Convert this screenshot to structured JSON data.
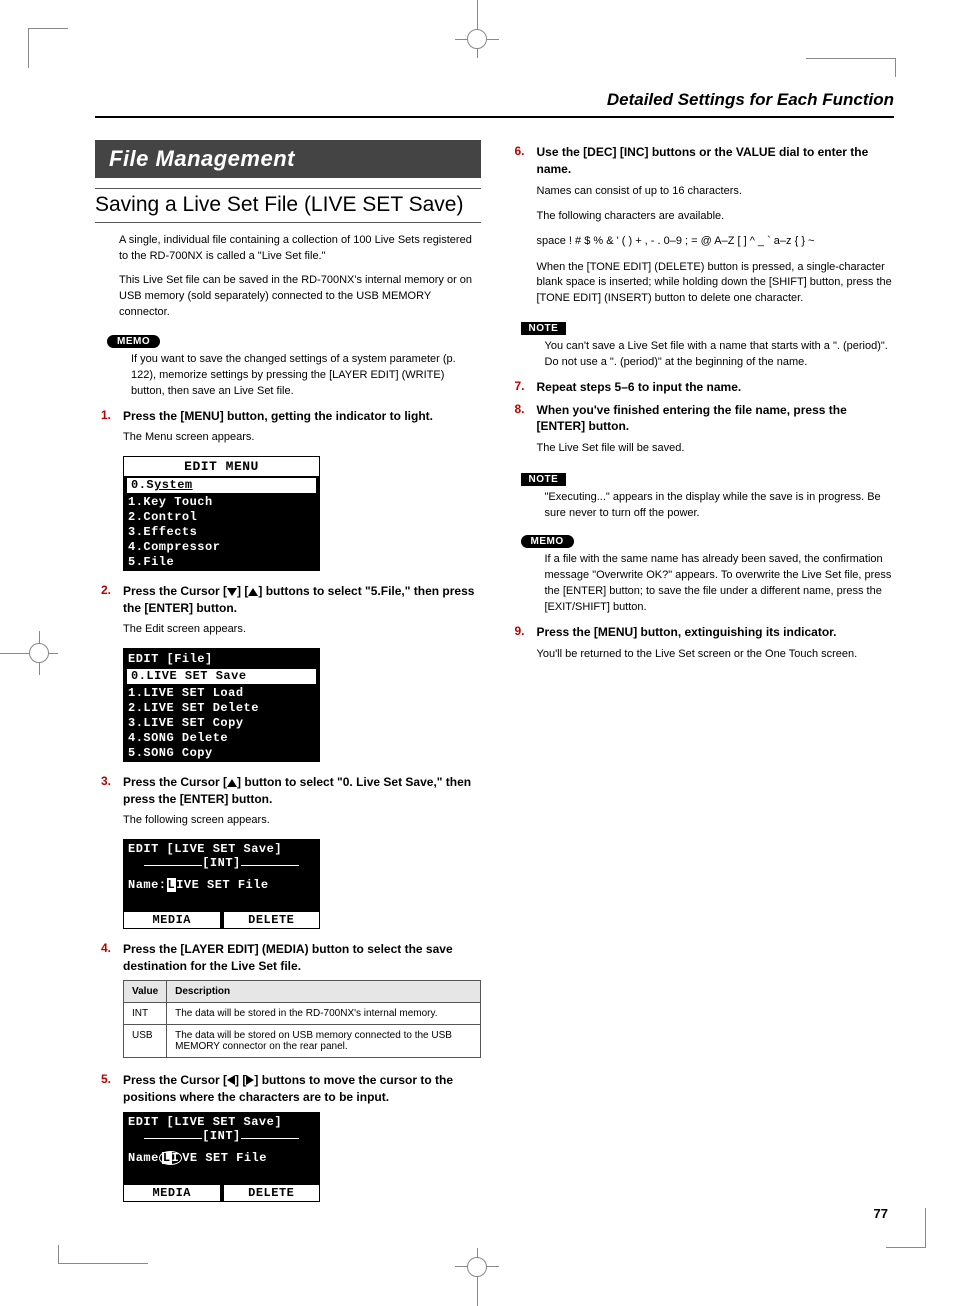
{
  "header": {
    "title": "Detailed Settings for Each Function",
    "page": "77"
  },
  "banner": "File Management",
  "subsection": "Saving a Live Set File  (LIVE SET Save)",
  "intro1": "A single, individual file containing a collection of 100 Live Sets registered to the RD-700NX is called a \"Live Set file.\"",
  "intro2": "This Live Set file can be saved in the RD-700NX's internal memory or on USB memory (sold separately) connected to the USB MEMORY connector.",
  "memo1": {
    "label": "MEMO",
    "text": "If you want to save the changed settings of a system parameter (p. 122), memorize settings by pressing the [LAYER EDIT] (WRITE) button, then save an Live Set file."
  },
  "steps": {
    "s1": {
      "num": "1.",
      "text": "Press the [MENU] button, getting the indicator to light.",
      "note": "The Menu screen appears."
    },
    "s2": {
      "num": "2.",
      "prefix": "Press the Cursor [",
      "mid1": "] [",
      "mid2": "] buttons to select \"5.File,\" then press the [ENTER] button.",
      "note": "The Edit screen appears."
    },
    "s3": {
      "num": "3.",
      "prefix": "Press the Cursor [",
      "mid": "] button to select \"0. Live Set Save,\" then press the [ENTER] button.",
      "note": "The following screen appears."
    },
    "s4": {
      "num": "4.",
      "text": "Press the [LAYER EDIT] (MEDIA) button to select the save destination for the Live Set file."
    },
    "s5": {
      "num": "5.",
      "prefix": "Press the Cursor [",
      "mid1": "] [",
      "mid2": "] buttons to move the cursor to the positions where the characters are to be input."
    },
    "s6": {
      "num": "6.",
      "text": "Use the [DEC] [INC] buttons or the VALUE dial to enter the name.",
      "note1": "Names can consist of up to 16 characters.",
      "note2": "The following characters are available.",
      "chars": "space ! # $ % & ' ( ) + , - . 0–9 ; = @ A–Z [ ] ^ _ ` a–z { } ~",
      "note3": "When the [TONE EDIT] (DELETE) button is pressed, a single-character blank space is inserted; while holding down the [SHIFT] button, press the [TONE EDIT] (INSERT) button to delete one character."
    },
    "s7": {
      "num": "7.",
      "text": "Repeat steps 5–6 to input the name."
    },
    "s8": {
      "num": "8.",
      "text": "When you've finished entering the file name, press the [ENTER] button.",
      "note": "The Live Set file will be saved."
    },
    "s9": {
      "num": "9.",
      "text": "Press the [MENU] button, extinguishing its indicator.",
      "note": "You'll be returned to the Live Set screen or the One Touch screen."
    }
  },
  "note1": {
    "label": "NOTE",
    "text": "You can't save a Live Set file with a name that starts with a \". (period)\". Do not use a \". (period)\" at the beginning of the name."
  },
  "note2": {
    "label": "NOTE",
    "text": "\"Executing...\" appears in the display while the save is in progress. Be sure never to turn off the power."
  },
  "memo2": {
    "label": "MEMO",
    "text": "If a file with the same name has already been saved, the confirmation message \"Overwrite OK?\" appears. To overwrite the Live Set file, press the [ENTER] button; to save the file under a different name, press the [EXIT/SHIFT] button."
  },
  "screen1": {
    "title": "EDIT MENU",
    "sel_pfx": "0.S",
    "sel_u": "ystem",
    "lines": [
      "1.Key Touch",
      "2.Control",
      "3.Effects",
      "4.Compressor",
      "5.File"
    ]
  },
  "screen2": {
    "title": "EDIT [File]",
    "sel": "0.LIVE SET Save",
    "lines": [
      "1.LIVE SET Load",
      "2.LIVE SET Delete",
      "3.LIVE SET Copy",
      "4.SONG Delete",
      "5.SONG Copy"
    ]
  },
  "screen3": {
    "title": "EDIT [LIVE SET Save]",
    "sub": "[INT]",
    "body_pfx": "Name:",
    "cursor": "L",
    "body_sfx": "IVE SET File",
    "foot_l": "MEDIA",
    "foot_r": "DELETE"
  },
  "screen4": {
    "title": "EDIT [LIVE SET Save]",
    "sub": "[INT]",
    "body_pfx": "Name",
    "cursor": "L",
    "body_mid": "I",
    "body_sfx": "VE SET File",
    "foot_l": "MEDIA",
    "foot_r": "DELETE"
  },
  "table": {
    "h1": "Value",
    "h2": "Description",
    "r1c1": "INT",
    "r1c2": "The data will be stored in the RD-700NX's internal memory.",
    "r2c1": "USB",
    "r2c2": "The data will be stored on USB memory connected to the USB MEMORY connector on the rear panel."
  }
}
